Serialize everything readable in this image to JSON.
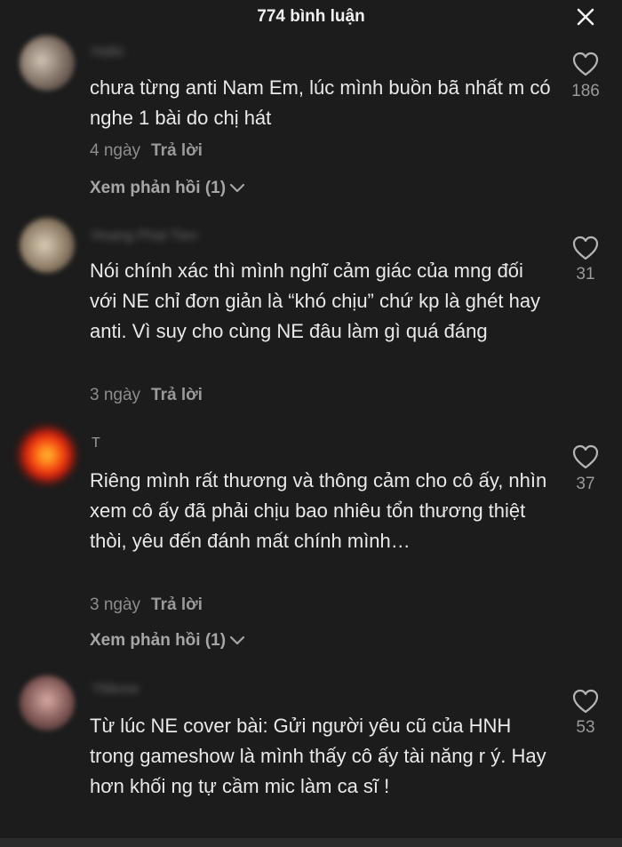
{
  "header": {
    "title": "774 bình luận",
    "close_icon": "close-icon"
  },
  "comments": [
    {
      "username": "Hallo",
      "text": "chưa từng anti Nam Em, lúc mình buồn bã nhất m có nghe 1 bài do chị hát",
      "time": "4 ngày",
      "reply_label": "Trả lời",
      "likes": "186",
      "view_replies": "Xem phản hồi (1)"
    },
    {
      "username": "Hoang Phat Tien",
      "text": "Nói chính xác thì mình nghĩ cảm giác của mng đối với NE chỉ đơn giản là “khó chịu” chứ kp là ghét hay anti. Vì suy cho cùng NE đâu làm gì quá đáng",
      "time": "3 ngày",
      "reply_label": "Trả lời",
      "likes": "31"
    },
    {
      "username": "T",
      "text": "Riêng mình rất thương và thông cảm cho cô ấy, nhìn xem cô ấy đã phải chịu bao nhiêu tổn thương thiệt thòi, yêu đến đánh mất chính mình…",
      "time": "3 ngày",
      "reply_label": "Trả lời",
      "likes": "37",
      "view_replies": "Xem phản hồi (1)"
    },
    {
      "username": "YMeow",
      "text": "Từ lúc NE cover bài: Gửi người yêu cũ của HNH trong gameshow là mình thấy cô ấy tài năng r ý. Hay hơn khối ng tự cầm mic làm ca sĩ !",
      "likes": "53"
    }
  ],
  "colors": {
    "background": "#1c1c1c",
    "text": "#e9e9e9",
    "muted": "#8d8d8d"
  }
}
